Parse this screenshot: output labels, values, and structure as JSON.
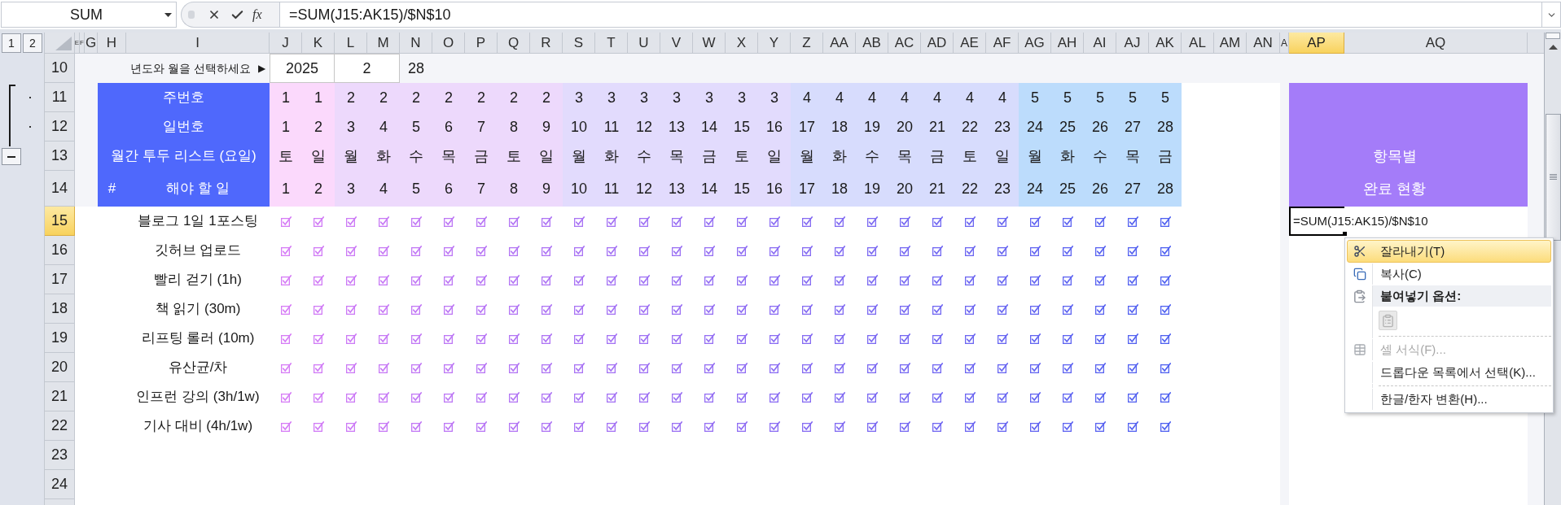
{
  "formula_bar": {
    "name_box": "SUM",
    "function_label": "fx",
    "formula": "=SUM(J15:AK15)/$N$10"
  },
  "outline_levels": [
    "1",
    "2"
  ],
  "columns": [
    {
      "label": "E",
      "selected": false
    },
    {
      "label": "F",
      "selected": false
    },
    {
      "label": "G",
      "selected": false
    },
    {
      "label": "H",
      "selected": false
    },
    {
      "label": "I",
      "selected": false
    },
    {
      "label": "J",
      "selected": false
    },
    {
      "label": "K",
      "selected": false
    },
    {
      "label": "L",
      "selected": false
    },
    {
      "label": "M",
      "selected": false
    },
    {
      "label": "N",
      "selected": false
    },
    {
      "label": "O",
      "selected": false
    },
    {
      "label": "P",
      "selected": false
    },
    {
      "label": "Q",
      "selected": false
    },
    {
      "label": "R",
      "selected": false
    },
    {
      "label": "S",
      "selected": false
    },
    {
      "label": "T",
      "selected": false
    },
    {
      "label": "U",
      "selected": false
    },
    {
      "label": "V",
      "selected": false
    },
    {
      "label": "W",
      "selected": false
    },
    {
      "label": "X",
      "selected": false
    },
    {
      "label": "Y",
      "selected": false
    },
    {
      "label": "Z",
      "selected": false
    },
    {
      "label": "AA",
      "selected": false
    },
    {
      "label": "AB",
      "selected": false
    },
    {
      "label": "AC",
      "selected": false
    },
    {
      "label": "AD",
      "selected": false
    },
    {
      "label": "AE",
      "selected": false
    },
    {
      "label": "AF",
      "selected": false
    },
    {
      "label": "AG",
      "selected": false
    },
    {
      "label": "AH",
      "selected": false
    },
    {
      "label": "AI",
      "selected": false
    },
    {
      "label": "AJ",
      "selected": false
    },
    {
      "label": "AK",
      "selected": false
    },
    {
      "label": "AL",
      "selected": false
    },
    {
      "label": "AM",
      "selected": false
    },
    {
      "label": "AN",
      "selected": false
    },
    {
      "label": "A",
      "selected": false
    },
    {
      "label": "AP",
      "selected": true
    },
    {
      "label": "AQ",
      "selected": false
    }
  ],
  "rows": [
    {
      "label": "10",
      "selected": false
    },
    {
      "label": "11",
      "selected": false
    },
    {
      "label": "12",
      "selected": false
    },
    {
      "label": "13",
      "selected": false
    },
    {
      "label": "14",
      "selected": false
    },
    {
      "label": "15",
      "selected": true
    },
    {
      "label": "16",
      "selected": false
    },
    {
      "label": "17",
      "selected": false
    },
    {
      "label": "18",
      "selected": false
    },
    {
      "label": "19",
      "selected": false
    },
    {
      "label": "20",
      "selected": false
    },
    {
      "label": "21",
      "selected": false
    },
    {
      "label": "22",
      "selected": false
    },
    {
      "label": "23",
      "selected": false
    },
    {
      "label": "24",
      "selected": false
    }
  ],
  "period_picker": {
    "prompt": "년도와 월을 선택하세요",
    "arrow": "▶",
    "year": "2025",
    "month": "2",
    "days_in_month": "28"
  },
  "header": {
    "week_label": "주번호",
    "day_label": "일번호",
    "weekday_label": "월간 투두 리스트 (요일)",
    "number_label": "#",
    "task_label": "해야 할 일",
    "weeks": [
      {
        "color": "#fbd9fc",
        "days": [
          {
            "week": "1",
            "date": "1",
            "weekday": "토",
            "index": "1"
          },
          {
            "week": "1",
            "date": "2",
            "weekday": "일",
            "index": "2"
          }
        ]
      },
      {
        "color": "#edd9fc",
        "days": [
          {
            "week": "2",
            "date": "3",
            "weekday": "월",
            "index": "3"
          },
          {
            "week": "2",
            "date": "4",
            "weekday": "화",
            "index": "4"
          },
          {
            "week": "2",
            "date": "5",
            "weekday": "수",
            "index": "5"
          },
          {
            "week": "2",
            "date": "6",
            "weekday": "목",
            "index": "6"
          },
          {
            "week": "2",
            "date": "7",
            "weekday": "금",
            "index": "7"
          },
          {
            "week": "2",
            "date": "8",
            "weekday": "토",
            "index": "8"
          },
          {
            "week": "2",
            "date": "9",
            "weekday": "일",
            "index": "9"
          }
        ]
      },
      {
        "color": "#e2dbfd",
        "days": [
          {
            "week": "3",
            "date": "10",
            "weekday": "월",
            "index": "10"
          },
          {
            "week": "3",
            "date": "11",
            "weekday": "화",
            "index": "11"
          },
          {
            "week": "3",
            "date": "12",
            "weekday": "수",
            "index": "12"
          },
          {
            "week": "3",
            "date": "13",
            "weekday": "목",
            "index": "13"
          },
          {
            "week": "3",
            "date": "14",
            "weekday": "금",
            "index": "14"
          },
          {
            "week": "3",
            "date": "15",
            "weekday": "토",
            "index": "15"
          },
          {
            "week": "3",
            "date": "16",
            "weekday": "일",
            "index": "16"
          }
        ]
      },
      {
        "color": "#d7dcfd",
        "days": [
          {
            "week": "4",
            "date": "17",
            "weekday": "월",
            "index": "17"
          },
          {
            "week": "4",
            "date": "18",
            "weekday": "화",
            "index": "18"
          },
          {
            "week": "4",
            "date": "19",
            "weekday": "수",
            "index": "19"
          },
          {
            "week": "4",
            "date": "20",
            "weekday": "목",
            "index": "20"
          },
          {
            "week": "4",
            "date": "21",
            "weekday": "금",
            "index": "21"
          },
          {
            "week": "4",
            "date": "22",
            "weekday": "토",
            "index": "22"
          },
          {
            "week": "4",
            "date": "23",
            "weekday": "일",
            "index": "23"
          }
        ]
      },
      {
        "color": "#bcdcfc",
        "days": [
          {
            "week": "5",
            "date": "24",
            "weekday": "월",
            "index": "24"
          },
          {
            "week": "5",
            "date": "25",
            "weekday": "화",
            "index": "25"
          },
          {
            "week": "5",
            "date": "26",
            "weekday": "수",
            "index": "26"
          },
          {
            "week": "5",
            "date": "27",
            "weekday": "목",
            "index": "27"
          },
          {
            "week": "5",
            "date": "28",
            "weekday": "금",
            "index": "28"
          }
        ]
      }
    ]
  },
  "summary_header": {
    "lines": [
      "항목별",
      "완료 현황"
    ]
  },
  "tasks": [
    {
      "name": "블로그 1일 1포스팅",
      "checked": [
        true,
        true,
        true,
        true,
        true,
        true,
        true,
        true,
        true,
        true,
        true,
        true,
        true,
        true,
        true,
        true,
        true,
        true,
        true,
        true,
        true,
        true,
        true,
        true,
        true,
        true,
        true,
        true
      ]
    },
    {
      "name": "깃허브 업로드",
      "checked": [
        true,
        true,
        true,
        true,
        true,
        true,
        true,
        true,
        true,
        true,
        true,
        true,
        true,
        true,
        true,
        true,
        true,
        true,
        true,
        true,
        true,
        true,
        true,
        true,
        true,
        true,
        true,
        true
      ]
    },
    {
      "name": "빨리 걷기 (1h)",
      "checked": [
        true,
        true,
        true,
        true,
        true,
        true,
        true,
        true,
        true,
        true,
        true,
        true,
        true,
        true,
        true,
        true,
        true,
        true,
        true,
        true,
        true,
        true,
        true,
        true,
        true,
        true,
        true,
        true
      ]
    },
    {
      "name": "책 읽기 (30m)",
      "checked": [
        true,
        true,
        true,
        true,
        true,
        true,
        true,
        true,
        true,
        true,
        true,
        true,
        true,
        true,
        true,
        true,
        true,
        true,
        true,
        true,
        true,
        true,
        true,
        true,
        true,
        true,
        true,
        true
      ]
    },
    {
      "name": "리프팅 롤러 (10m)",
      "checked": [
        true,
        true,
        true,
        true,
        true,
        true,
        true,
        true,
        true,
        true,
        true,
        true,
        true,
        true,
        true,
        true,
        true,
        true,
        true,
        true,
        true,
        true,
        true,
        true,
        true,
        true,
        true,
        true
      ]
    },
    {
      "name": "유산균/차",
      "checked": [
        true,
        true,
        true,
        true,
        true,
        true,
        true,
        true,
        true,
        true,
        true,
        true,
        true,
        true,
        true,
        true,
        true,
        true,
        true,
        true,
        true,
        true,
        true,
        true,
        true,
        true,
        true,
        true
      ]
    },
    {
      "name": "인프런 강의 (3h/1w)",
      "checked": [
        true,
        true,
        true,
        true,
        true,
        true,
        true,
        true,
        true,
        true,
        true,
        true,
        true,
        true,
        true,
        true,
        true,
        true,
        true,
        true,
        true,
        true,
        true,
        true,
        true,
        true,
        true,
        true
      ]
    },
    {
      "name": "기사 대비 (4h/1w)",
      "checked": [
        true,
        true,
        true,
        true,
        true,
        true,
        true,
        true,
        true,
        true,
        true,
        true,
        true,
        true,
        true,
        true,
        true,
        true,
        true,
        true,
        true,
        true,
        true,
        true,
        true,
        true,
        true,
        true
      ]
    }
  ],
  "active_cell": {
    "text": "=SUM(J15:AK15)/$N$10"
  },
  "context_menu": {
    "items": [
      {
        "kind": "command",
        "label": "잘라내기(T)",
        "selected": true,
        "disabled": false
      },
      {
        "kind": "command",
        "label": "복사(C)",
        "selected": false,
        "disabled": false
      },
      {
        "kind": "heading",
        "label": "붙여넣기 옵션:"
      },
      {
        "kind": "paste_options",
        "disabled": true
      },
      {
        "kind": "separator"
      },
      {
        "kind": "command",
        "label": "셀 서식(F)...",
        "selected": false,
        "disabled": true
      },
      {
        "kind": "command",
        "label": "드롭다운 목록에서 선택(K)...",
        "selected": false,
        "disabled": false
      },
      {
        "kind": "separator"
      },
      {
        "kind": "command",
        "label": "한글/한자 변환(H)...",
        "selected": false,
        "disabled": false
      }
    ]
  }
}
